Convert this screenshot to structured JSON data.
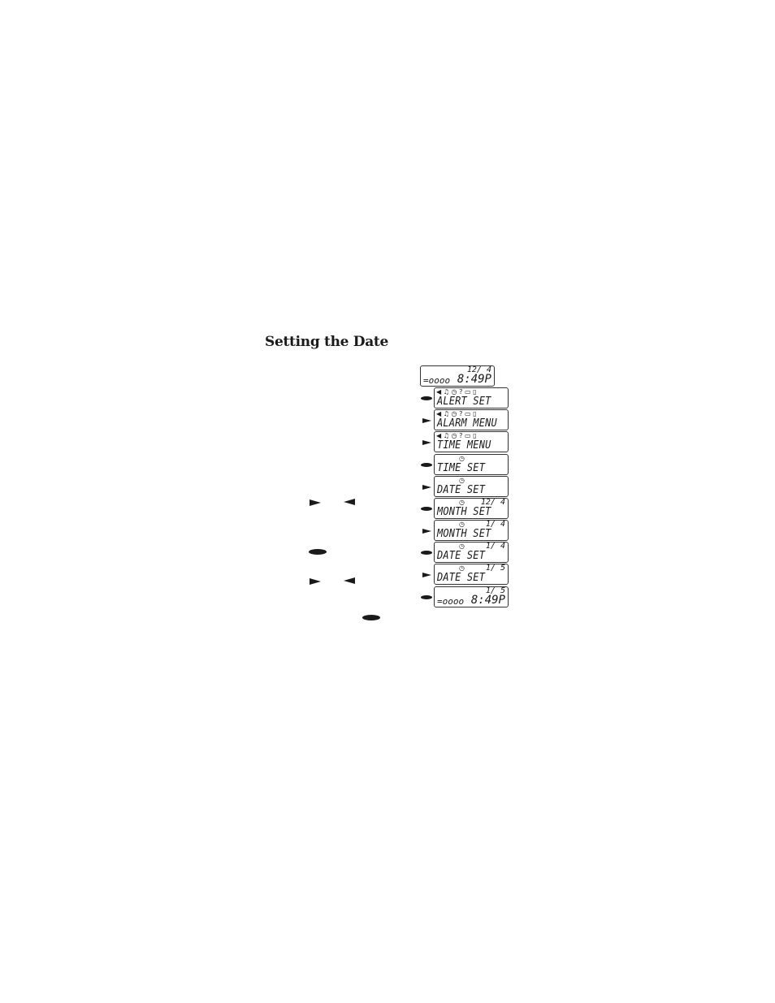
{
  "page": {
    "title": "Setting the Date"
  },
  "inline_glyphs": {
    "row1": {
      "right": "next-button",
      "left": "previous-button"
    },
    "row2": {
      "oval": "select-button"
    },
    "row3": {
      "right": "next-button",
      "left": "previous-button"
    },
    "row4": {
      "oval": "select-button"
    }
  },
  "screens": [
    {
      "key": "none",
      "icons": "",
      "clock": false,
      "date": "12/ 4",
      "main": "",
      "ooo": "=oooo",
      "time": "8:49P"
    },
    {
      "key": "select",
      "icons": "◀ ♫ ◷ ? ▭ ▯",
      "clock": false,
      "date": "",
      "main": "ALERT SET"
    },
    {
      "key": "next",
      "icons": "◀ ♫ ◷ ? ▭ ▯",
      "clock": false,
      "date": "",
      "main": "ALARM MENU"
    },
    {
      "key": "next",
      "icons": "◀ ♫ ◷ ? ▭ ▯",
      "clock": false,
      "date": "",
      "main": "TIME MENU"
    },
    {
      "key": "select",
      "icons": "",
      "clock": true,
      "date": "",
      "main": "TIME SET"
    },
    {
      "key": "next",
      "icons": "",
      "clock": true,
      "date": "",
      "main": "DATE SET"
    },
    {
      "key": "select",
      "icons": "",
      "clock": true,
      "date": "12/ 4",
      "main": "MONTH SET"
    },
    {
      "key": "next",
      "icons": "",
      "clock": true,
      "date": "1/ 4",
      "main": "MONTH SET"
    },
    {
      "key": "select",
      "icons": "",
      "clock": true,
      "date": "1/ 4",
      "main": "DATE SET"
    },
    {
      "key": "next",
      "icons": "",
      "clock": true,
      "date": "1/ 5",
      "main": "DATE SET"
    },
    {
      "key": "select",
      "icons": "",
      "clock": false,
      "date": "1/ 5",
      "main": "",
      "ooo": "=oooo",
      "time": "8:49P"
    }
  ],
  "clock_glyph": "◷"
}
